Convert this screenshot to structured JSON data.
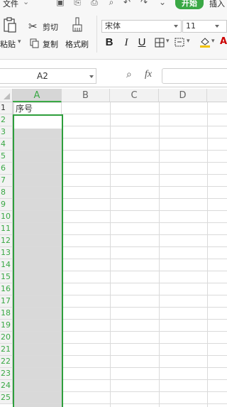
{
  "topbar": {
    "file_menu": "文件",
    "start_tab": "开始",
    "insert_tab": "插入"
  },
  "ribbon": {
    "paste_label": "粘贴",
    "cut_label": "剪切",
    "copy_label": "复制",
    "format_painter_label": "格式刷",
    "font_name": "宋体",
    "font_size": "11",
    "bold": "B",
    "italic": "I",
    "underline": "U"
  },
  "formula": {
    "cell_ref": "A2",
    "fx": "fx"
  },
  "sheet": {
    "columns": [
      "A",
      "B",
      "C",
      "D"
    ],
    "rows": [
      "1",
      "2",
      "3",
      "4",
      "5",
      "6",
      "7",
      "8",
      "9",
      "10",
      "11",
      "12",
      "13",
      "14",
      "15",
      "16",
      "17",
      "18",
      "19",
      "20",
      "21",
      "22",
      "23",
      "24",
      "25"
    ],
    "cells": {
      "A1": "序号"
    },
    "selected_column": "A",
    "active_cell": "A2"
  },
  "colors": {
    "accent": "#3aa845",
    "selection_border": "#2e9e3c",
    "selection_fill": "#d9d9d9",
    "row_number_selected": "#3aa845"
  }
}
